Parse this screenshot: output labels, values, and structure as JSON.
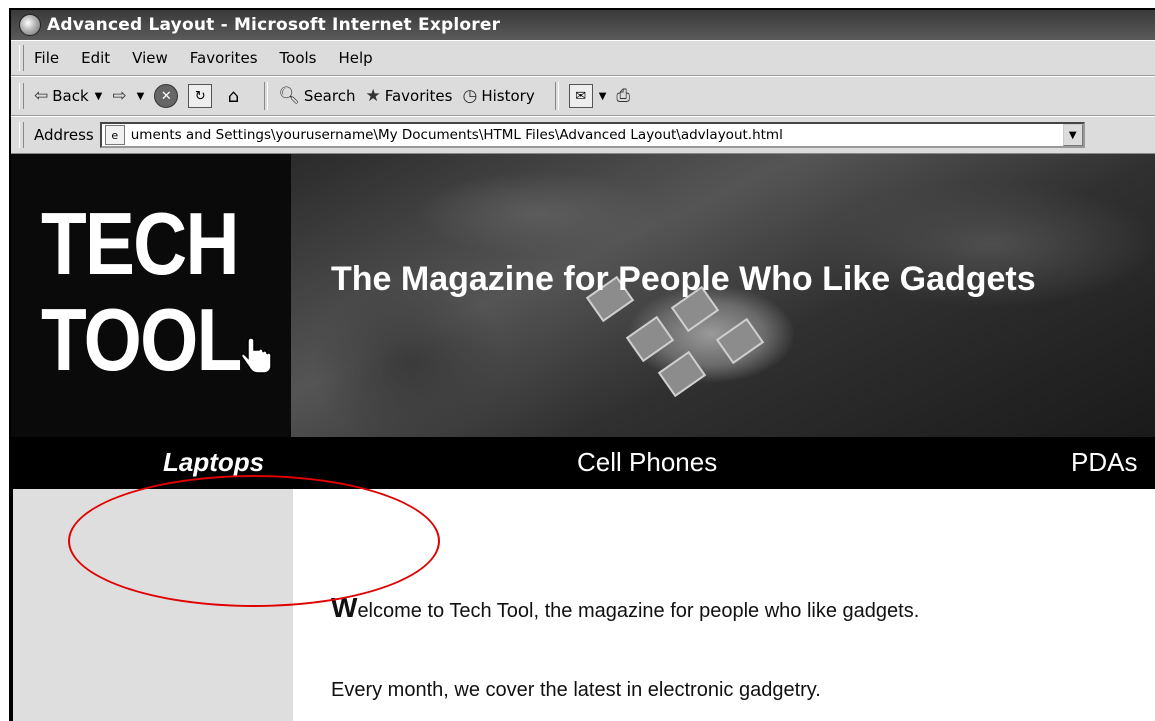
{
  "window": {
    "title": "Advanced Layout - Microsoft Internet Explorer"
  },
  "menu": [
    "File",
    "Edit",
    "View",
    "Favorites",
    "Tools",
    "Help"
  ],
  "toolbar": {
    "back": "Back",
    "search": "Search",
    "favorites": "Favorites",
    "history": "History"
  },
  "address": {
    "label": "Address",
    "value": "uments and Settings\\yourusername\\My Documents\\HTML Files\\Advanced Layout\\advlayout.html"
  },
  "page": {
    "logo_line1": "TECH",
    "logo_line2": "TOOL",
    "tagline": "The Magazine for People Who Like Gadgets",
    "nav": [
      "Laptops",
      "Cell Phones",
      "PDAs"
    ],
    "nav_active_index": 0,
    "welcome_dropcap": "W",
    "welcome_rest": "elcome to Tech Tool, the magazine for people who like gadgets.",
    "paragraph2": "Every month, we cover the latest in electronic gadgetry."
  },
  "colors": {
    "annotation": "#e00000",
    "banner": "#0a0a0a",
    "sidebar": "#dedede"
  }
}
